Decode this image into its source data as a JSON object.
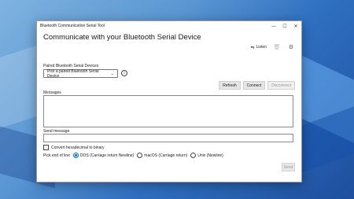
{
  "window": {
    "app_title": "Bluetooth Communication Serial Tool",
    "controls": {
      "minimize": "—",
      "maximize": "☐",
      "close": "✕"
    }
  },
  "main": {
    "heading": "Communicate with your Bluetooth Serial Device",
    "listen_label": "Listen",
    "paired_label": "Paired Bluetooth Serial Devices",
    "device_select_value": "Pick a paired Bluetooth Serial Device",
    "info_glyph": "i",
    "buttons": {
      "refresh": "Refresh",
      "connect": "Connect",
      "disconnect": "Disconnect"
    },
    "messages_label": "Messages",
    "send_message_label": "Send message",
    "hex_label": "Convert hexadecimal to binary",
    "eol": {
      "label": "Pick end of line",
      "options": [
        "DOS (Carriage return Newline)",
        "macOS (Carriage return)",
        "Unix (Newline)"
      ],
      "selected": "DOS (Carriage return Newline)"
    },
    "send_button": "Send"
  },
  "icons": {
    "listen": "listen-icon",
    "clear": "trash-icon",
    "settings": "gear-icon",
    "info": "info-icon"
  },
  "colors": {
    "accent": "#0067c0"
  }
}
